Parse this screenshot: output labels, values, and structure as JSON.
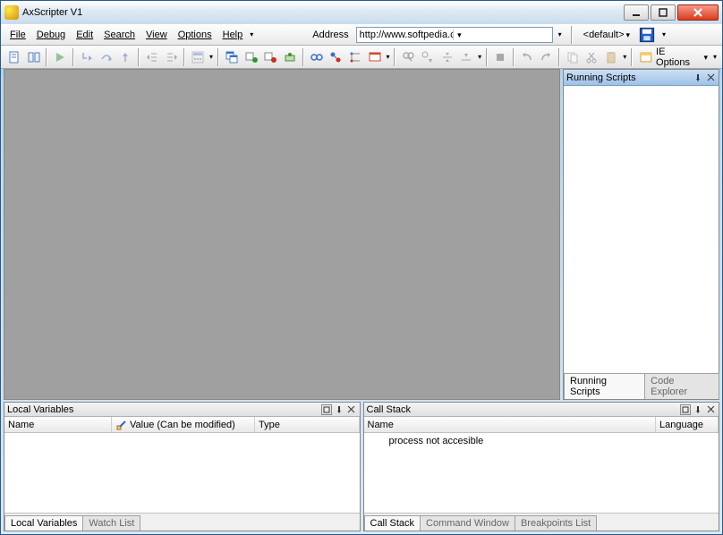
{
  "title": "AxScripter V1",
  "menu": [
    "File",
    "Debug",
    "Edit",
    "Search",
    "View",
    "Options",
    "Help"
  ],
  "address": {
    "label": "Address",
    "value": "http://www.softpedia.com"
  },
  "default_label": "<default>",
  "ie_options_label": "IE Options",
  "right_panel": {
    "title": "Running Scripts",
    "tabs": [
      "Running Scripts",
      "Code Explorer"
    ]
  },
  "local_vars": {
    "title": "Local Variables",
    "cols": {
      "name": "Name",
      "value": "Value (Can be modified)",
      "type": "Type"
    },
    "tabs": [
      "Local Variables",
      "Watch List"
    ]
  },
  "call_stack": {
    "title": "Call Stack",
    "cols": {
      "name": "Name",
      "lang": "Language"
    },
    "rows": [
      "process not accesible"
    ],
    "tabs": [
      "Call Stack",
      "Command Window",
      "Breakpoints List"
    ]
  }
}
